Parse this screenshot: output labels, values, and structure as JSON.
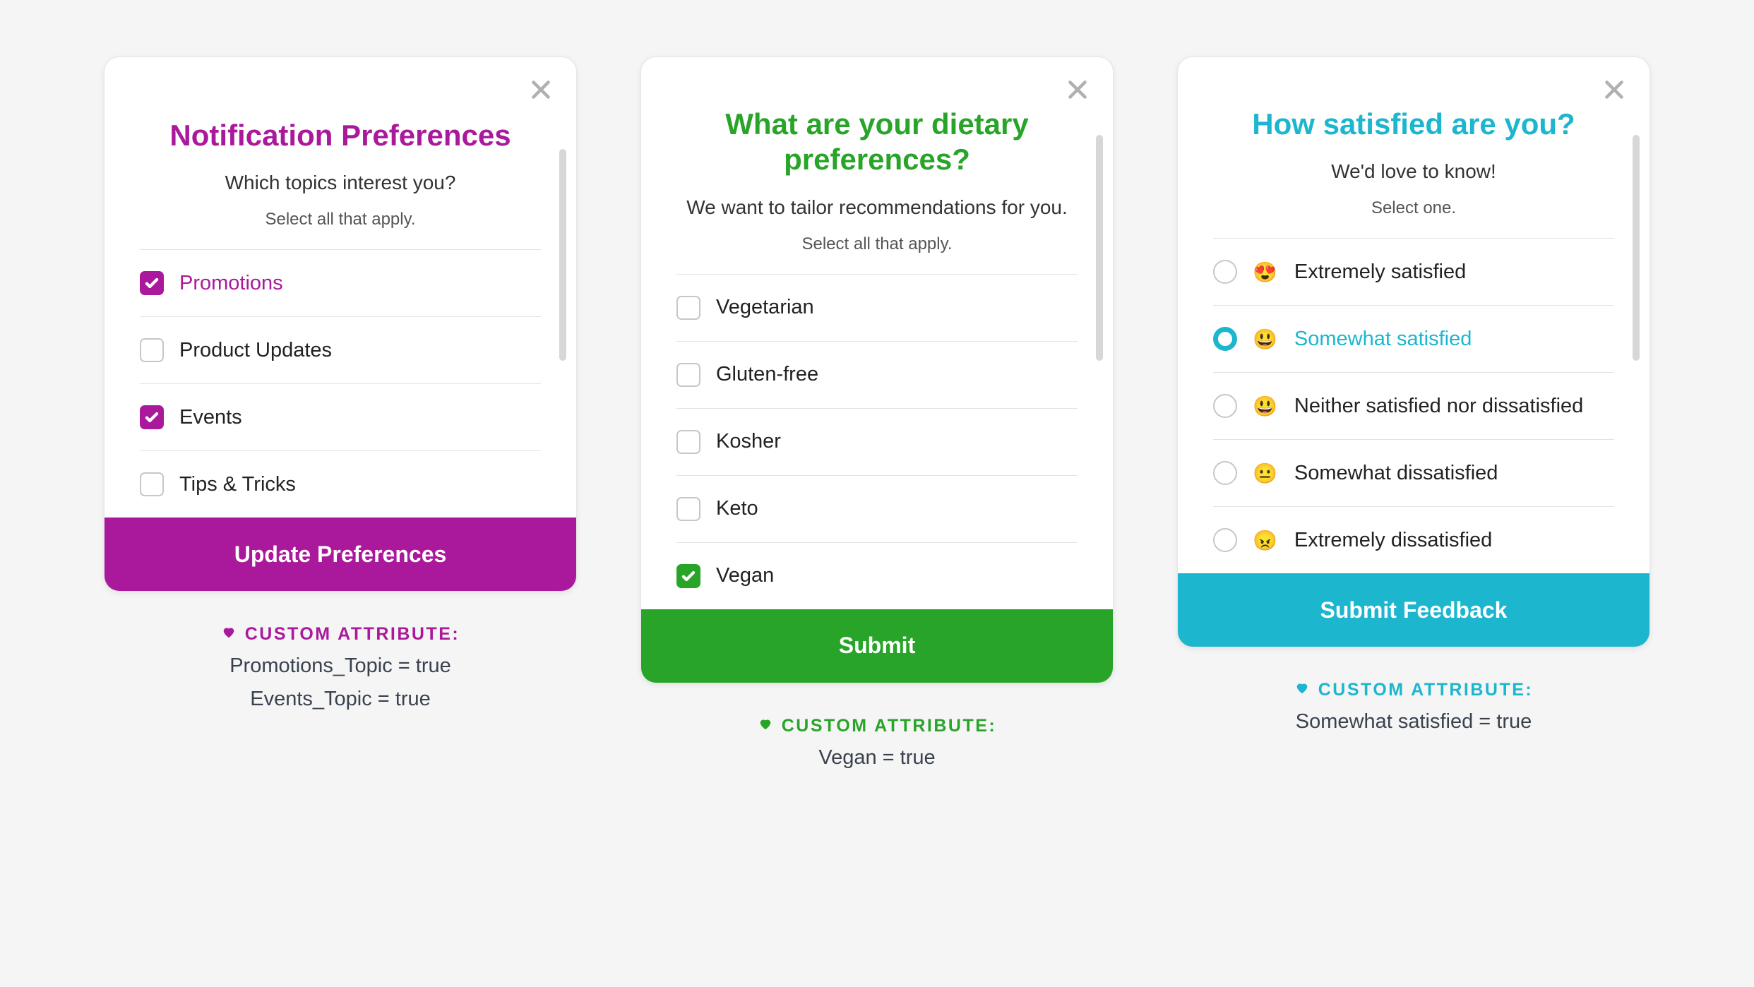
{
  "cards": [
    {
      "title": "Notification Preferences",
      "subtitle": "Which topics interest you?",
      "hint": "Select all that apply.",
      "options": [
        {
          "label": "Promotions",
          "checked": true
        },
        {
          "label": "Product Updates",
          "checked": false
        },
        {
          "label": "Events",
          "checked": true
        },
        {
          "label": "Tips & Tricks",
          "checked": false
        }
      ],
      "submit": "Update Preferences",
      "accent": "#aa189c",
      "meta_label": "CUSTOM ATTRIBUTE:",
      "meta_lines": [
        "Promotions_Topic = true",
        "Events_Topic = true"
      ]
    },
    {
      "title": "What are your dietary preferences?",
      "subtitle": "We want to tailor recommendations for you.",
      "hint": "Select all that apply.",
      "options": [
        {
          "label": "Vegetarian",
          "checked": false
        },
        {
          "label": "Gluten-free",
          "checked": false
        },
        {
          "label": "Kosher",
          "checked": false
        },
        {
          "label": "Keto",
          "checked": false
        },
        {
          "label": "Vegan",
          "checked": true
        }
      ],
      "submit": "Submit",
      "accent": "#28a528",
      "meta_label": "CUSTOM ATTRIBUTE:",
      "meta_lines": [
        "Vegan = true"
      ]
    },
    {
      "title": "How satisfied are you?",
      "subtitle": "We'd love to know!",
      "hint": "Select one.",
      "options": [
        {
          "label": "Extremely satisfied",
          "emoji": "😍",
          "selected": false
        },
        {
          "label": "Somewhat satisfied",
          "emoji": "😃",
          "selected": true
        },
        {
          "label": "Neither satisfied nor dissatisfied",
          "emoji": "😃",
          "selected": false
        },
        {
          "label": "Somewhat dissatisfied",
          "emoji": "😐",
          "selected": false
        },
        {
          "label": "Extremely dissatisfied",
          "emoji": "😠",
          "selected": false
        }
      ],
      "submit": "Submit Feedback",
      "accent": "#1cb6ce",
      "meta_label": "CUSTOM ATTRIBUTE:",
      "meta_lines": [
        "Somewhat satisfied = true"
      ]
    }
  ]
}
